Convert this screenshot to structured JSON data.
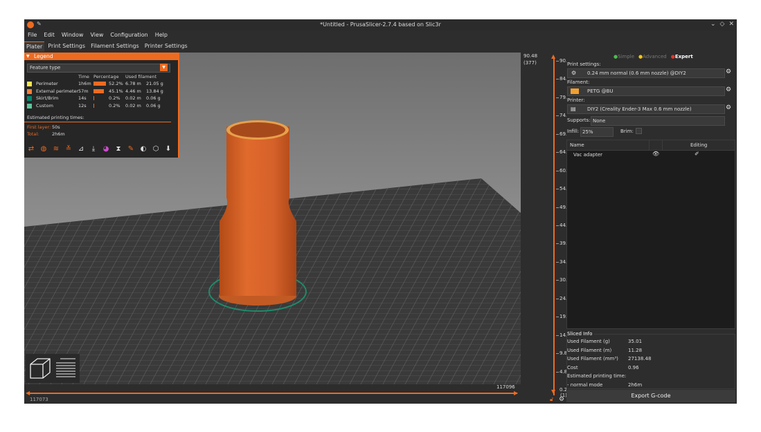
{
  "window": {
    "title": "*Untitled - PrusaSlicer-2.7.4 based on Slic3r"
  },
  "menu": [
    "File",
    "Edit",
    "Window",
    "View",
    "Configuration",
    "Help"
  ],
  "tabs": [
    "Plater",
    "Print Settings",
    "Filament Settings",
    "Printer Settings"
  ],
  "legend": {
    "title": "Legend",
    "feature_select": "Feature type",
    "columns": [
      "Time",
      "Percentage",
      "Used filament"
    ],
    "rows": [
      {
        "name": "Perimeter",
        "time": "1h6m",
        "percent": "52.2%",
        "percent_value": 52.2,
        "length": "6.78 m",
        "weight": "21.05 g",
        "color": "#ffe64d"
      },
      {
        "name": "External perimeter",
        "time": "57m",
        "percent": "45.1%",
        "percent_value": 45.1,
        "length": "4.46 m",
        "weight": "13.84 g",
        "color": "#ff7d38"
      },
      {
        "name": "Skirt/Brim",
        "time": "14s",
        "percent": "0.2%",
        "percent_value": 0.2,
        "length": "0.02 m",
        "weight": "0.06 g",
        "color": "#00876e"
      },
      {
        "name": "Custom",
        "time": "12s",
        "percent": "0.2%",
        "percent_value": 0.2,
        "length": "0.02 m",
        "weight": "0.06 g",
        "color": "#5ec79b"
      }
    ],
    "est_title": "Estimated printing times:",
    "first_layer_label": "First layer:",
    "first_layer_value": "50s",
    "total_label": "Total:",
    "total_value": "2h6m"
  },
  "hslider": {
    "right_value": "117096",
    "left_value": "117073"
  },
  "vslider": {
    "top_value": "90.48",
    "top_layer": "(377)",
    "bottom_value": "0.24",
    "bottom_layer": "(1)",
    "ticks": [
      "90.00",
      "84.96",
      "79.92",
      "74.88",
      "69.84",
      "64.80",
      "60.00",
      "54.96",
      "49.92",
      "44.88",
      "39.84",
      "34.80",
      "30.00",
      "24.96",
      "19.92",
      "14.88",
      "9.84",
      "4.80",
      "0.24"
    ]
  },
  "sidebar": {
    "modes": [
      "Simple",
      "Advanced",
      "Expert"
    ],
    "print_settings_label": "Print settings:",
    "print_settings_value": "0.24 mm normal (0.6 mm nozzle) @DIY2",
    "filament_label": "Filament:",
    "filament_value": "PETG @BU",
    "printer_label": "Printer:",
    "printer_value": "DIY2 (Creality Ender-3 Max 0.6 mm nozzle)",
    "supports_label": "Supports:",
    "supports_value": "None",
    "infill_label": "Infill:",
    "infill_value": "25%",
    "brim_label": "Brim:",
    "list_headers": [
      "Name",
      "Editing"
    ],
    "objects": [
      "Vac adapter"
    ],
    "sliced_title": "Sliced Info",
    "sliced_rows": [
      {
        "label": "Used Filament (g)",
        "value": "35.01"
      },
      {
        "label": "Used Filament (m)",
        "value": "11.28"
      },
      {
        "label": "Used Filament (mm³)",
        "value": "27138.48"
      },
      {
        "label": "Cost",
        "value": "0.96"
      },
      {
        "label": "Estimated printing time:",
        "value": ""
      },
      {
        "label": " - normal mode",
        "value": "2h6m"
      }
    ],
    "export_label": "Export G-code"
  },
  "colors": {
    "accent": "#ed6b21",
    "model": "#d9652b",
    "mode_simple": "#48c14d",
    "mode_advanced": "#f5c518",
    "mode_expert": "#e0382b"
  }
}
